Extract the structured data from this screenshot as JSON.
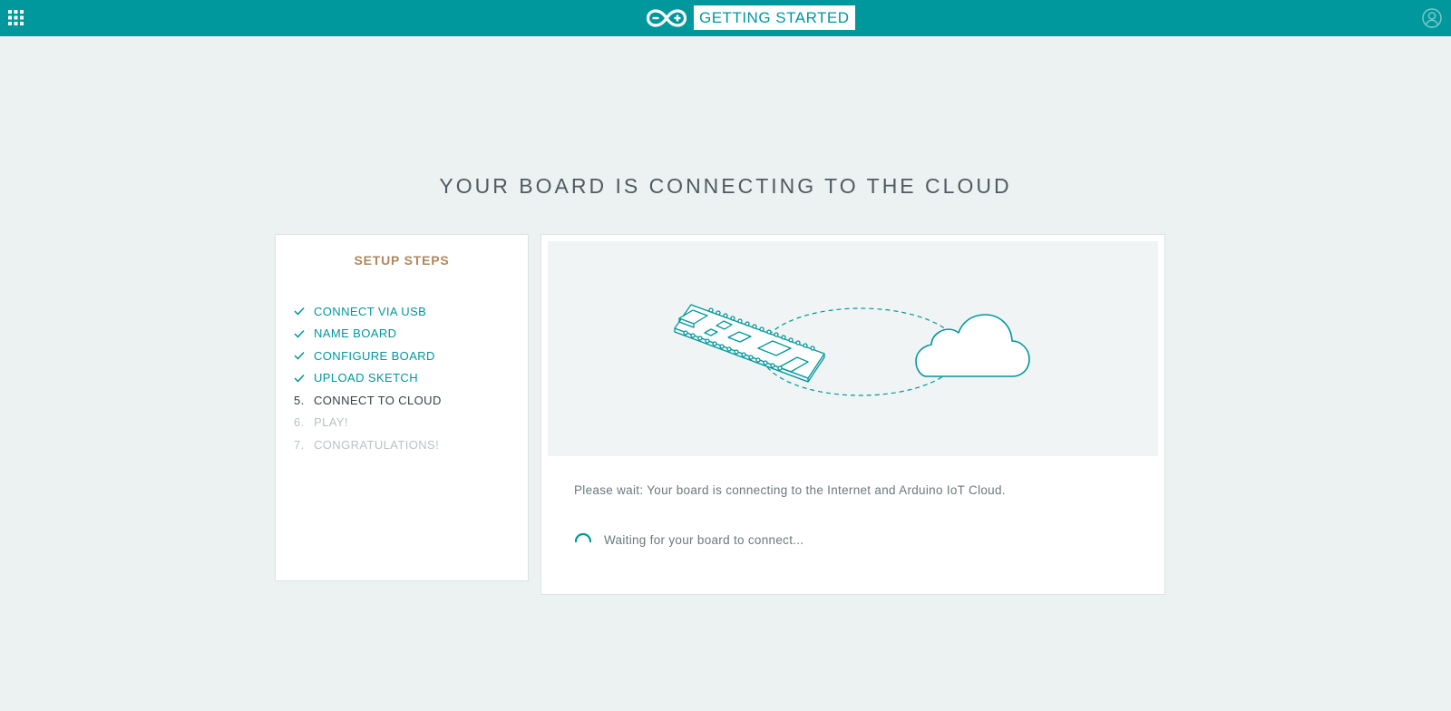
{
  "header": {
    "apps_icon": "grid-icon",
    "logo_icon": "arduino-infinity-logo",
    "title": "GETTING STARTED",
    "user_icon": "user-account-icon",
    "background_color": "#00979d"
  },
  "page": {
    "title": "YOUR BOARD IS CONNECTING TO THE CLOUD"
  },
  "setup_steps": {
    "heading": "SETUP STEPS",
    "steps": [
      {
        "marker": "",
        "label": "CONNECT VIA USB",
        "state": "done"
      },
      {
        "marker": "",
        "label": "NAME BOARD",
        "state": "done"
      },
      {
        "marker": "",
        "label": "CONFIGURE BOARD",
        "state": "done"
      },
      {
        "marker": "",
        "label": "UPLOAD SKETCH",
        "state": "done"
      },
      {
        "marker": "5.",
        "label": "CONNECT TO CLOUD",
        "state": "current"
      },
      {
        "marker": "6.",
        "label": "PLAY!",
        "state": "pending"
      },
      {
        "marker": "7.",
        "label": "CONGRATULATIONS!",
        "state": "pending"
      }
    ]
  },
  "main": {
    "illustration_icons": [
      "board-icon",
      "cloud-icon"
    ],
    "status_message": "Please wait: Your board is connecting to the Internet and Arduino IoT Cloud.",
    "waiting_message": "Waiting for your board to connect...",
    "spinner_icon": "loading-spinner-icon"
  },
  "colors": {
    "accent": "#00979d",
    "heading_brown": "#b0875f",
    "page_background": "#ecf1f1"
  }
}
